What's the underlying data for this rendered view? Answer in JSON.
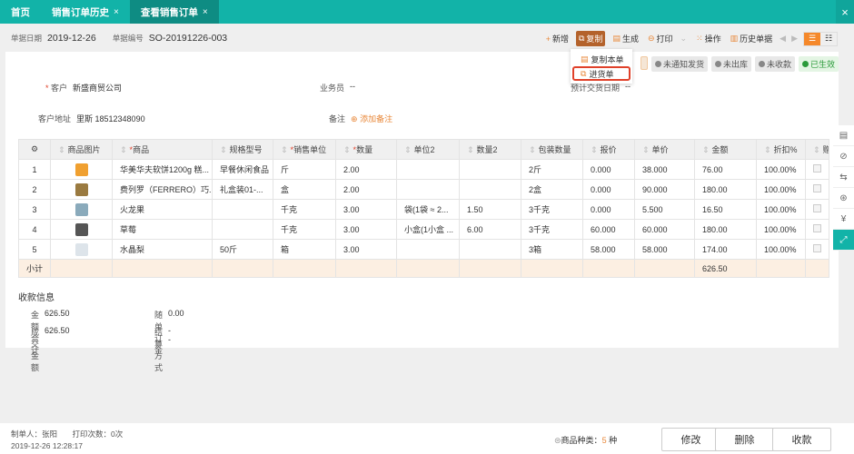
{
  "tabs": [
    {
      "label": "首页"
    },
    {
      "label": "销售订单历史"
    },
    {
      "label": "查看销售订单"
    }
  ],
  "close_glyph": "×",
  "info": {
    "date_label": "单据日期",
    "date": "2019-12-26",
    "no_label": "单据编号",
    "no": "SO-20191226-003"
  },
  "toolbar": {
    "add": "新增",
    "copy": "复制",
    "generate": "生成",
    "print": "打印",
    "operate": "操作",
    "history": "历史单据"
  },
  "copy_menu": [
    "复制本单",
    "进货单"
  ],
  "statuses": [
    "未通知发货",
    "未出库",
    "未收款",
    "已生效"
  ],
  "form": {
    "customer_label": "客户",
    "customer": "新盛商贸公司",
    "salesman_label": "业务员",
    "salesman": "--",
    "delivery_label": "预计交货日期",
    "delivery": "--",
    "address_label": "客户地址",
    "address": "里斯 18512348090",
    "note_label": "备注",
    "note_add": "添加备注"
  },
  "table": {
    "headers": [
      "商品图片",
      "商品",
      "规格型号",
      "销售单位",
      "数量",
      "单位2",
      "数量2",
      "包装数量",
      "报价",
      "单价",
      "金额",
      "折扣%",
      "赠"
    ],
    "rows": [
      {
        "no": "1",
        "name": "华美华夫软饼1200g 糕...",
        "spec": "早餐休闲食品",
        "unit": "斤",
        "qty": "2.00",
        "unit2": "",
        "qty2": "",
        "pack": "2斤",
        "quote": "0.000",
        "price": "38.000",
        "amount": "76.00",
        "discount": "100.00%",
        "thumb": "#f0a030"
      },
      {
        "no": "2",
        "name": "费列罗（FERRERO）巧...",
        "spec": "礼盒装01-...",
        "unit": "盒",
        "qty": "2.00",
        "unit2": "",
        "qty2": "",
        "pack": "2盒",
        "quote": "0.000",
        "price": "90.000",
        "amount": "180.00",
        "discount": "100.00%",
        "thumb": "#9a7a40"
      },
      {
        "no": "3",
        "name": "火龙果",
        "spec": "",
        "unit": "千克",
        "qty": "3.00",
        "unit2": "袋(1袋 ≈ 2...",
        "qty2": "1.50",
        "pack": "3千克",
        "quote": "0.000",
        "price": "5.500",
        "amount": "16.50",
        "discount": "100.00%",
        "thumb": "#8aaabb"
      },
      {
        "no": "4",
        "name": "草莓",
        "spec": "",
        "unit": "千克",
        "qty": "3.00",
        "unit2": "小盒(1小盒 ...",
        "qty2": "6.00",
        "pack": "3千克",
        "quote": "60.000",
        "price": "60.000",
        "amount": "180.00",
        "discount": "100.00%",
        "thumb": "#555"
      },
      {
        "no": "5",
        "name": "水晶梨",
        "spec": "50斤",
        "unit": "箱",
        "qty": "3.00",
        "unit2": "",
        "qty2": "",
        "pack": "3箱",
        "quote": "58.000",
        "price": "58.000",
        "amount": "174.00",
        "discount": "100.00%",
        "thumb": "#dde4ea"
      }
    ],
    "subtotal_label": "小计",
    "subtotal_amount": "626.50"
  },
  "payment": {
    "title": "收款信息",
    "total_label": "金额合计",
    "total": "626.50",
    "deposit_label": "随单订金",
    "deposit": "0.00",
    "deal_label": "成交金额",
    "deal": "626.50",
    "settle_label": "结算方式",
    "settle": "--"
  },
  "footer": {
    "maker": "制单人：张阳",
    "prints": "打印次数：0次",
    "time": "2019-12-26 12:28:17",
    "kinds_label": "商品种类：",
    "kinds": "5",
    "kinds_unit": "种",
    "edit": "修改",
    "delete": "删除",
    "collect": "收款"
  }
}
